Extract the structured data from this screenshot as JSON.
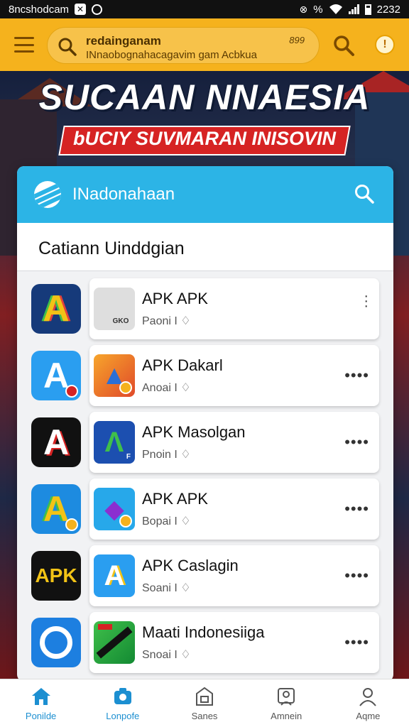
{
  "status_bar": {
    "left_text": "8ncshodcam",
    "time": "2232",
    "right_symbol": "%"
  },
  "topbar": {
    "search_title": "redainganam",
    "search_meta": "899",
    "search_subtitle": "INnaobognahacagavim gam Acbkua"
  },
  "banner": {
    "title": "SUCAAN NNAESIA",
    "ribbon": "bUCIY SUVMARAN INISOVIN"
  },
  "card": {
    "title": "INadonahaan",
    "section_title": "Catiann Uinddgian"
  },
  "apps": [
    {
      "name": "APK APK",
      "sub": "Paoni I",
      "tile_text": "A",
      "thumb_text": "GKO"
    },
    {
      "name": "APK Dakarl",
      "sub": "Anoai I",
      "tile_text": "A",
      "thumb_text": ""
    },
    {
      "name": "APK Masolgan",
      "sub": "Pnoin I",
      "tile_text": "A",
      "thumb_text": "F"
    },
    {
      "name": "APK APK",
      "sub": "Bopai I",
      "tile_text": "A",
      "thumb_text": ""
    },
    {
      "name": "APK Caslagin",
      "sub": "Soani I",
      "tile_text": "APK",
      "thumb_text": "A"
    },
    {
      "name": "Maati Indonesiiga",
      "sub": "Snoai I",
      "tile_text": "",
      "thumb_text": ""
    }
  ],
  "bottom_nav": [
    {
      "label": "Ponilde",
      "icon": "home-icon"
    },
    {
      "label": "Lonpofe",
      "icon": "camera-icon"
    },
    {
      "label": "Sanes",
      "icon": "store-icon"
    },
    {
      "label": "Amnein",
      "icon": "inbox-icon"
    },
    {
      "label": "Aqme",
      "icon": "profile-icon"
    }
  ],
  "colors": {
    "appbar": "#f5b21d",
    "card_header": "#2cb4e6",
    "nav_active": "#1c8fd1",
    "ribbon": "#d62323"
  }
}
